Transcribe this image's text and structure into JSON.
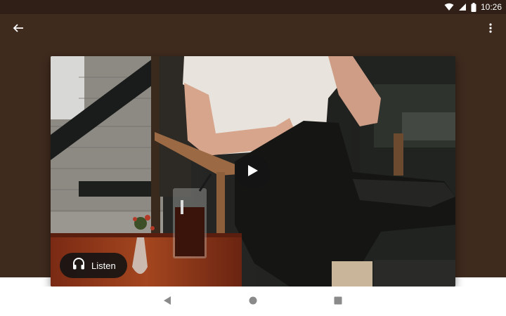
{
  "status_bar": {
    "time": "10:26",
    "icons": [
      "wifi-icon",
      "cell-signal-icon",
      "battery-icon"
    ]
  },
  "app_bar": {
    "back_icon": "arrow-back-icon",
    "overflow_icon": "more-vert-icon"
  },
  "media": {
    "play_icon": "play-icon",
    "listen_label": "Listen",
    "listen_icon": "headphones-icon"
  },
  "nav_bar": {
    "buttons": [
      "back-triangle-icon",
      "home-circle-icon",
      "recents-square-icon"
    ]
  },
  "colors": {
    "backdrop": "#3f2a1e",
    "status_bar": "#2f1f16",
    "overlay_button": "#141414",
    "nav_icons": "#8a8a8a"
  }
}
